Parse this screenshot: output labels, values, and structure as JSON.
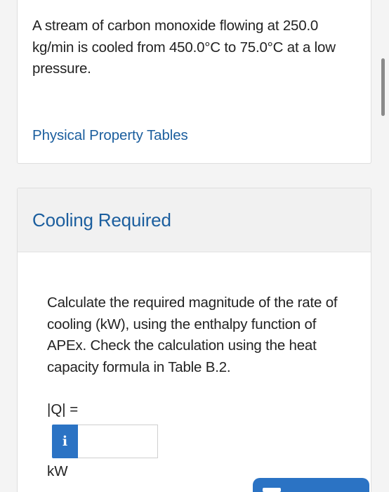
{
  "problem": {
    "text": "A stream of carbon monoxide flowing at 250.0 kg/min is cooled from 450.0°C to 75.0°C at a low pressure.",
    "link_label": "Physical Property Tables"
  },
  "section": {
    "title": "Cooling Required",
    "question": "Calculate the required magnitude of the rate of cooling (kW), using the enthalpy function of APEx. Check the calculation using the heat capacity formula in Table B.2.",
    "answer_label": "|Q| =",
    "info_glyph": "i",
    "answer_value": "",
    "unit": "kW"
  },
  "colors": {
    "link": "#1b5e9e",
    "accent": "#2b73c4",
    "header_bg": "#f1f1f1",
    "page_bg": "#f4f4f4"
  },
  "icons": {
    "info": "info-icon",
    "submit": "submit-icon"
  }
}
